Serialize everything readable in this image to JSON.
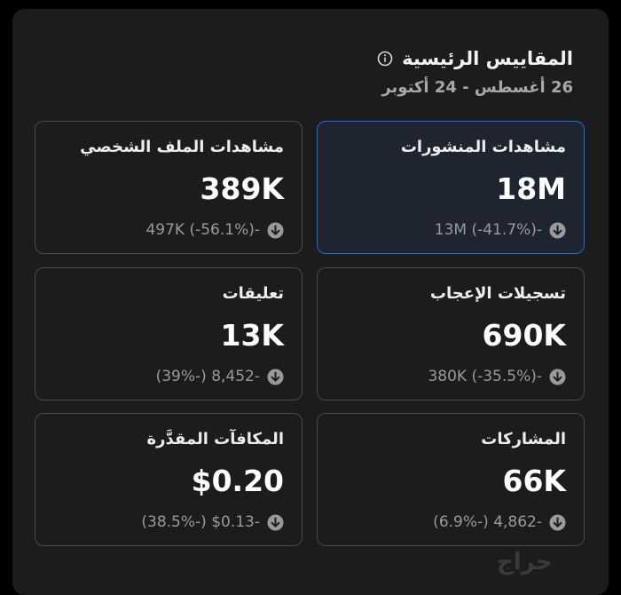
{
  "header": {
    "title": "المقاييس الرئيسية",
    "date_range": "26 أغسطس - 24 أكتوبر"
  },
  "metrics": [
    {
      "label": "مشاهدات المنشورات",
      "value": "18M",
      "change": "-13M (-41.7%)",
      "active": true
    },
    {
      "label": "مشاهدات الملف الشخصي",
      "value": "389K",
      "change": "-497K (-56.1%)",
      "active": false
    },
    {
      "label": "تسجيلات الإعجاب",
      "value": "690K",
      "change": "-380K (-35.5%)",
      "active": false
    },
    {
      "label": "تعليقات",
      "value": "13K",
      "change": "-8,452 (-39%)",
      "active": false
    },
    {
      "label": "المشاركات",
      "value": "66K",
      "change": "-4,862 (-6.9%)",
      "active": false
    },
    {
      "label": "المكافآت المقدَّرة",
      "value": "$0.20",
      "change": "-$0.13 (-38.5%)",
      "active": false
    }
  ],
  "watermark": "حراج",
  "colors": {
    "background": "#1c1c1e",
    "card_border": "#4a4a4d",
    "active_border": "#1e6fd9",
    "text_primary": "#ffffff",
    "text_secondary": "#9a9a9a"
  },
  "icons": {
    "info": "info-circle-icon",
    "change": "arrow-down-circle-icon"
  }
}
